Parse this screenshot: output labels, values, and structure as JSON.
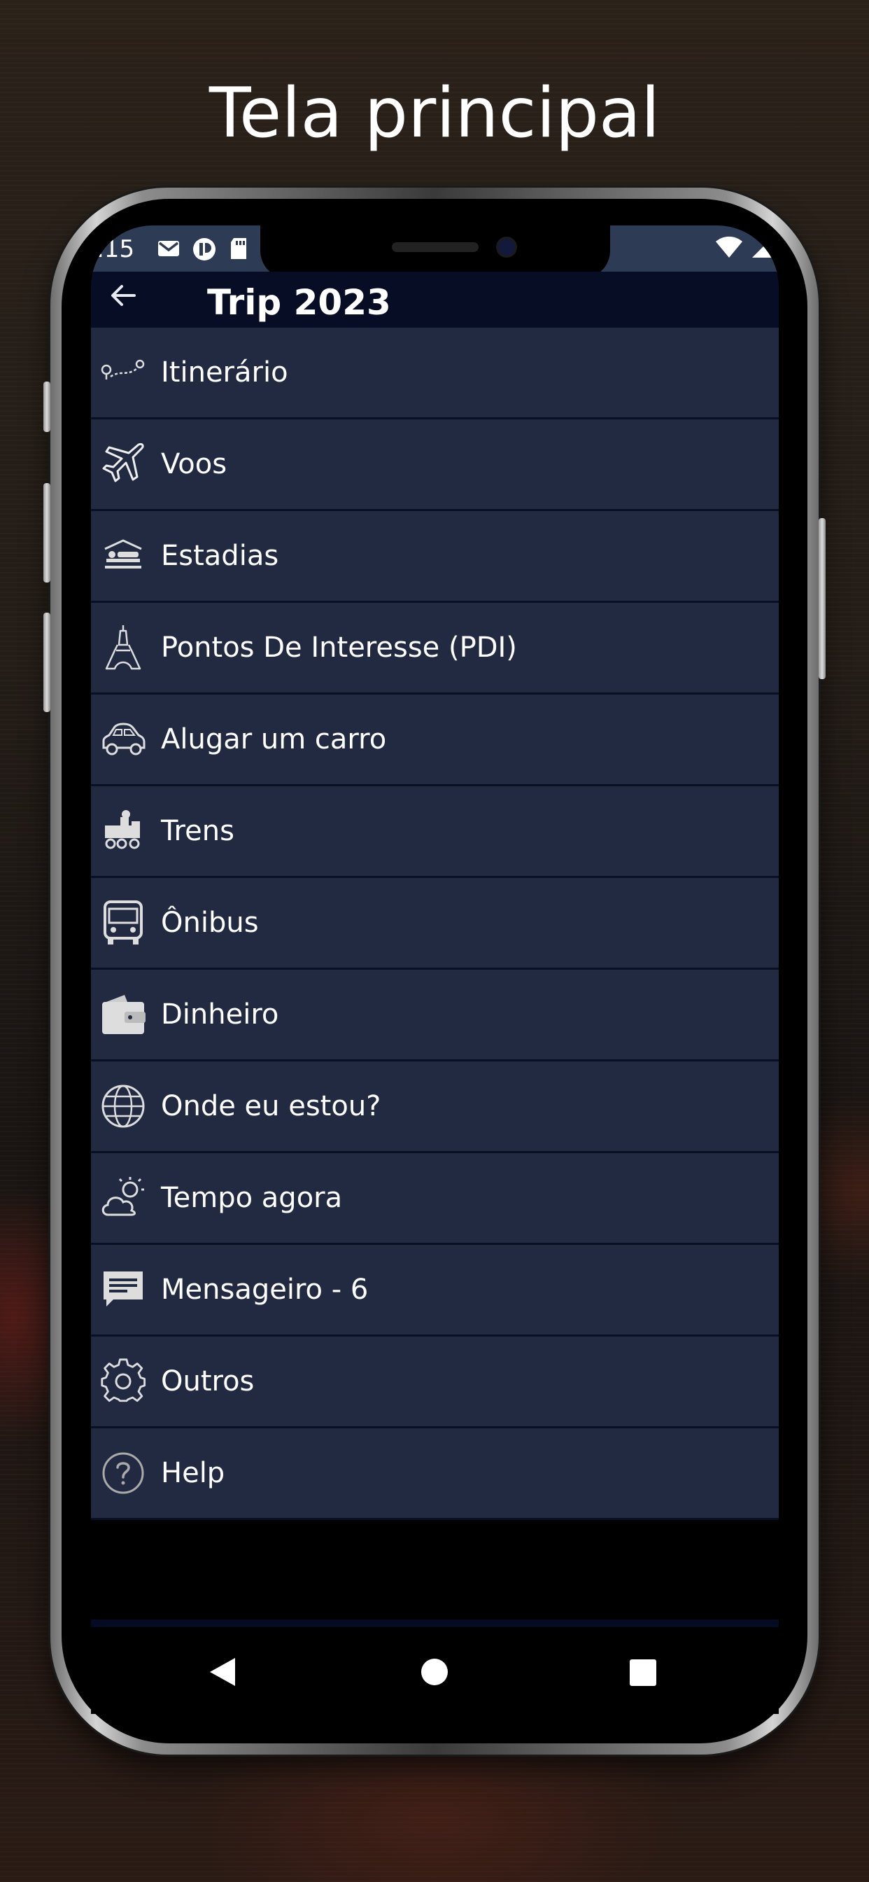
{
  "headline": "Tela principal",
  "status_bar": {
    "time": ".15"
  },
  "toolbar": {
    "title": "Trip 2023"
  },
  "menu": {
    "items": [
      {
        "label": "Itinerário",
        "icon": "route-icon"
      },
      {
        "label": "Voos",
        "icon": "airplane-icon"
      },
      {
        "label": "Estadias",
        "icon": "hotel-bed-icon"
      },
      {
        "label": "Pontos De Interesse (PDI)",
        "icon": "eiffel-tower-icon"
      },
      {
        "label": "Alugar um carro",
        "icon": "car-icon"
      },
      {
        "label": "Trens",
        "icon": "train-icon"
      },
      {
        "label": "Ônibus",
        "icon": "bus-icon"
      },
      {
        "label": "Dinheiro",
        "icon": "wallet-icon"
      },
      {
        "label": "Onde eu estou?",
        "icon": "globe-icon"
      },
      {
        "label": "Tempo agora",
        "icon": "weather-icon"
      },
      {
        "label": "Mensageiro - 6",
        "icon": "message-icon"
      },
      {
        "label": "Outros",
        "icon": "gear-icon"
      },
      {
        "label": "Help",
        "icon": "help-icon"
      }
    ]
  },
  "colors": {
    "status_bar": "#2e3b55",
    "toolbar": "#060d24",
    "menu_item": "#222a42",
    "divider": "#0a1024"
  }
}
